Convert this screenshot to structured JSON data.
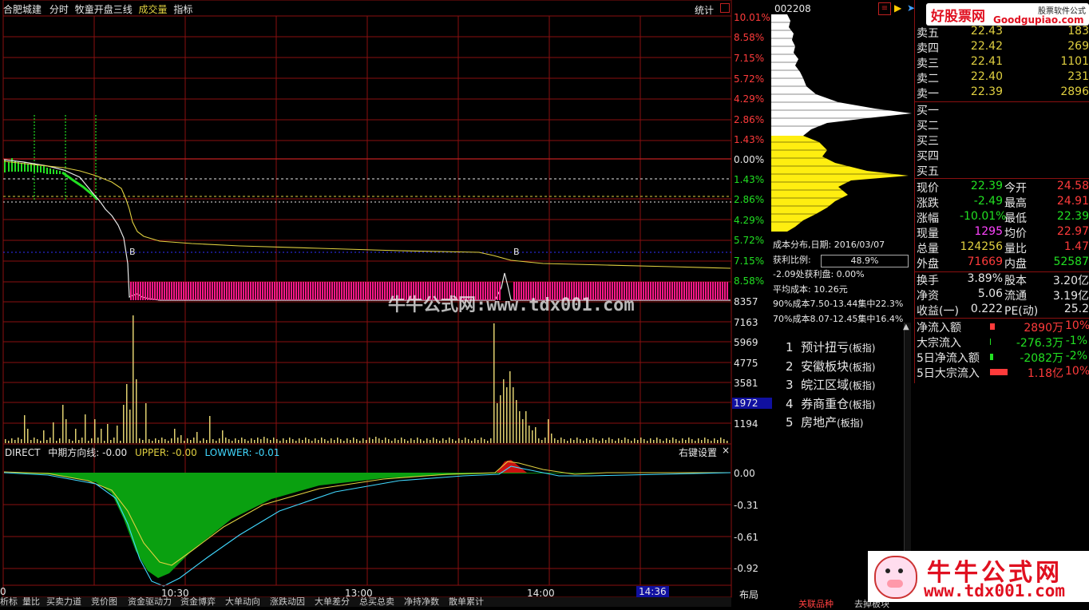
{
  "header": {
    "stock_name": "合肥城建",
    "mode": "分时",
    "formula": "牧童开盘三线",
    "vol_label": "成交量",
    "indicator": "指标",
    "stats_btn": "统计"
  },
  "price_axis": [
    "10.01%",
    "8.58%",
    "7.15%",
    "5.72%",
    "4.29%",
    "2.86%",
    "1.43%",
    "0.00%",
    "1.43%",
    "2.86%",
    "4.29%",
    "5.72%",
    "7.15%",
    "8.58%"
  ],
  "volume_axis": [
    "8357",
    "7163",
    "5969",
    "4775",
    "3581",
    "1972",
    "1194"
  ],
  "volume_highlight": "1972",
  "indicator_panel": {
    "name": "DIRECT",
    "line1": "中期方向线: -0.00",
    "line2": "UPPER: -0.00",
    "line3": "LOWWER: -0.01",
    "settings": "右键设置",
    "close": "×",
    "axis": [
      "0.00",
      "-0.31",
      "-0.61",
      "-0.92"
    ]
  },
  "time_axis": {
    "start": "0",
    "t1": "10:30",
    "t2": "13:00",
    "t3": "14:00",
    "cursor": "14:36",
    "layout": "布局"
  },
  "markers": {
    "b1": "B",
    "b2": "B"
  },
  "watermark": "牛牛公式网:www.tdx001.com",
  "bottom_tabs": [
    "析标",
    "量比",
    "买卖力道",
    "竞价图",
    "资金驱动力",
    "资金博弈",
    "大单动向",
    "涨跌动因",
    "大单差分",
    "总买总卖",
    "净持净数",
    "散单累计"
  ],
  "chip": {
    "code": "002208",
    "title": "成本分布,日期: 2016/03/07",
    "profit_label": "获利比例:",
    "profit_value": "48.9%",
    "line2": "-2.09处获利盘: 0.00%",
    "line3": "平均成本: 10.26元",
    "line4": "90%成本7.50-13.44集中22.3%",
    "line5": "70%成本8.07-12.45集中16.4%"
  },
  "sectors": [
    {
      "num": "1",
      "name": "预计扭亏",
      "tag": "(板指)"
    },
    {
      "num": "2",
      "name": "安徽板块",
      "tag": "(板指)"
    },
    {
      "num": "3",
      "name": "皖江区域",
      "tag": "(板指)"
    },
    {
      "num": "4",
      "name": "券商重仓",
      "tag": "(板指)"
    },
    {
      "num": "5",
      "name": "房地产",
      "tag": "(板指)"
    }
  ],
  "quote": {
    "asks": [
      {
        "label": "卖五",
        "price": "22.43",
        "vol": "183"
      },
      {
        "label": "卖四",
        "price": "22.42",
        "vol": "269"
      },
      {
        "label": "卖三",
        "price": "22.41",
        "vol": "1101"
      },
      {
        "label": "卖二",
        "price": "22.40",
        "vol": "231"
      },
      {
        "label": "卖一",
        "price": "22.39",
        "vol": "2896"
      }
    ],
    "bids": [
      {
        "label": "买一"
      },
      {
        "label": "买二"
      },
      {
        "label": "买三"
      },
      {
        "label": "买四"
      },
      {
        "label": "买五"
      }
    ],
    "stats": [
      {
        "l1": "现价",
        "v1": "22.39",
        "l2": "今开",
        "v2": "24.58"
      },
      {
        "l1": "涨跌",
        "v1": "-2.49",
        "l2": "最高",
        "v2": "24.91"
      },
      {
        "l1": "涨幅",
        "v1": "-10.01%",
        "l2": "最低",
        "v2": "22.39"
      },
      {
        "l1": "现量",
        "v1": "1295",
        "l2": "均价",
        "v2": "22.97"
      },
      {
        "l1": "总量",
        "v1": "124256",
        "l2": "量比",
        "v2": "1.47"
      },
      {
        "l1": "外盘",
        "v1": "71669",
        "l2": "内盘",
        "v2": "52587"
      }
    ],
    "fund": [
      {
        "l1": "换手",
        "v1": "3.89%",
        "l2": "股本",
        "v2": "3.20亿"
      },
      {
        "l1": "净资",
        "v1": "5.06",
        "l2": "流通",
        "v2": "3.19亿"
      },
      {
        "l1": "收益(一)",
        "v1": "0.222",
        "l2": "PE(动)",
        "v2": "25.2"
      }
    ],
    "flows": [
      {
        "label": "净流入额",
        "value": "2890万",
        "pct": "10%"
      },
      {
        "label": "大宗流入",
        "value": "-276.3万",
        "pct": "-1%"
      },
      {
        "label": "5日净流入额",
        "value": "-2082万",
        "pct": "-2%"
      },
      {
        "label": "5日大宗流入",
        "value": "1.18亿",
        "pct": "10%"
      }
    ]
  },
  "logo": {
    "brand": "好股票网",
    "site": "Goodgupiao.com",
    "tag": "股票软件公式"
  },
  "footer_logo": {
    "name": "牛牛公式网",
    "url": "www.tdx001.com"
  },
  "bottom_right_tabs": [
    "关联品种",
    "去掉板块"
  ]
}
